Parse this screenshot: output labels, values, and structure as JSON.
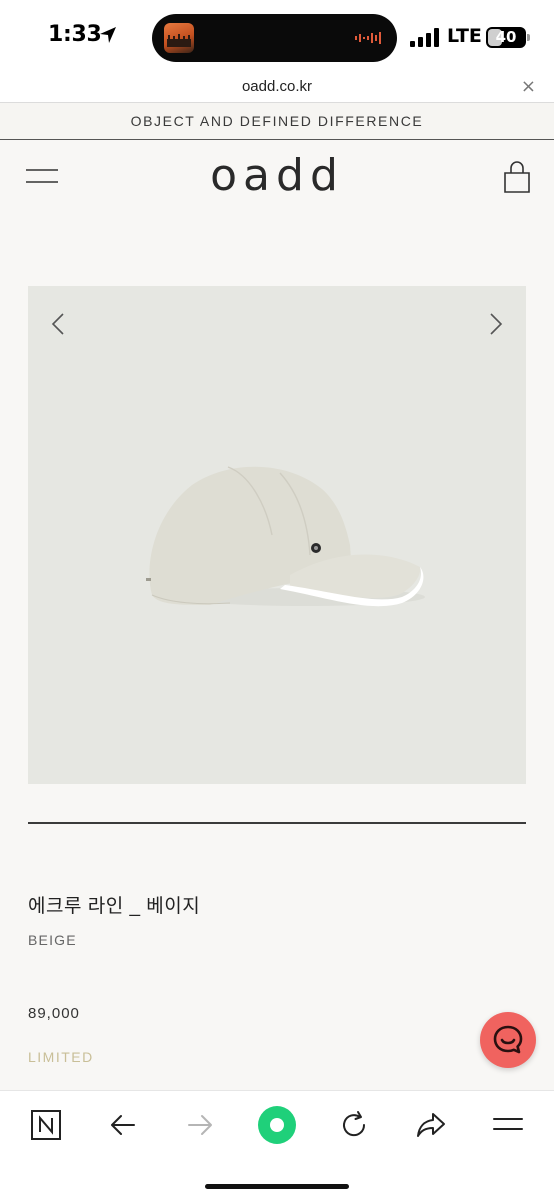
{
  "status_bar": {
    "time": "1:33",
    "network": "LTE",
    "battery": "40",
    "battery_level": 0.4
  },
  "browser": {
    "url": "oadd.co.kr",
    "close_label": "×"
  },
  "announcement": "OBJECT AND DEFINED DIFFERENCE",
  "header": {
    "logo": "oadd"
  },
  "product": {
    "name": "에크루 라인 _ 베이지",
    "color": "BEIGE",
    "price": "89,000",
    "status": "LIMITED",
    "image_background": "#e6e7e2"
  },
  "icons": {
    "menu": "hamburger-menu-icon",
    "cart": "shopping-bag-icon",
    "prev": "chevron-left-icon",
    "next": "chevron-right-icon",
    "chat": "chat-bubble-icon"
  },
  "toolbar": {
    "items": [
      "naver-home-icon",
      "back-arrow-icon",
      "forward-arrow-icon",
      "green-dot-icon",
      "reload-icon",
      "share-icon",
      "menu-icon"
    ]
  },
  "colors": {
    "accent_chat": "#f0635f",
    "status_limited": "#c9bf98",
    "toolbar_green": "#1fd07a"
  }
}
